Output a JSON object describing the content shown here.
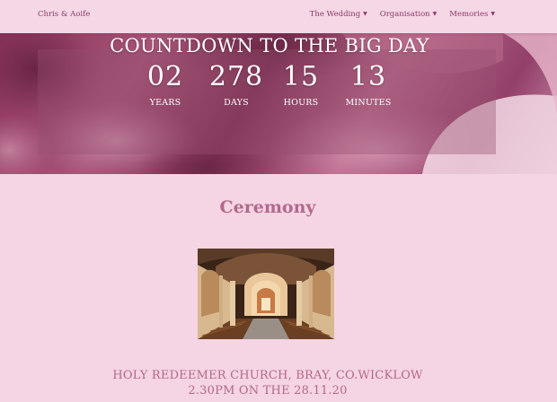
{
  "navbar": {
    "brand": "Chris & Aoife",
    "items": [
      {
        "label": "The Wedding"
      },
      {
        "label": "Organisation"
      },
      {
        "label": "Memories"
      }
    ]
  },
  "hero": {
    "title": "COUNTDOWN TO THE BIG DAY",
    "units": [
      {
        "value": "02",
        "label": "YEARS"
      },
      {
        "value": "278",
        "label": "DAYS"
      },
      {
        "value": "15",
        "label": "HOURS"
      },
      {
        "value": "13",
        "label": "MINUTES"
      }
    ]
  },
  "ceremony": {
    "title": "Ceremony",
    "venue": "HOLY REDEEMER CHURCH, BRAY, CO.WICKLOW",
    "time": "2.30PM ON THE 28.11.20"
  },
  "colors": {
    "background": "#f5d4e3",
    "accent": "#b2698b",
    "nav_text": "#8c3a64"
  }
}
